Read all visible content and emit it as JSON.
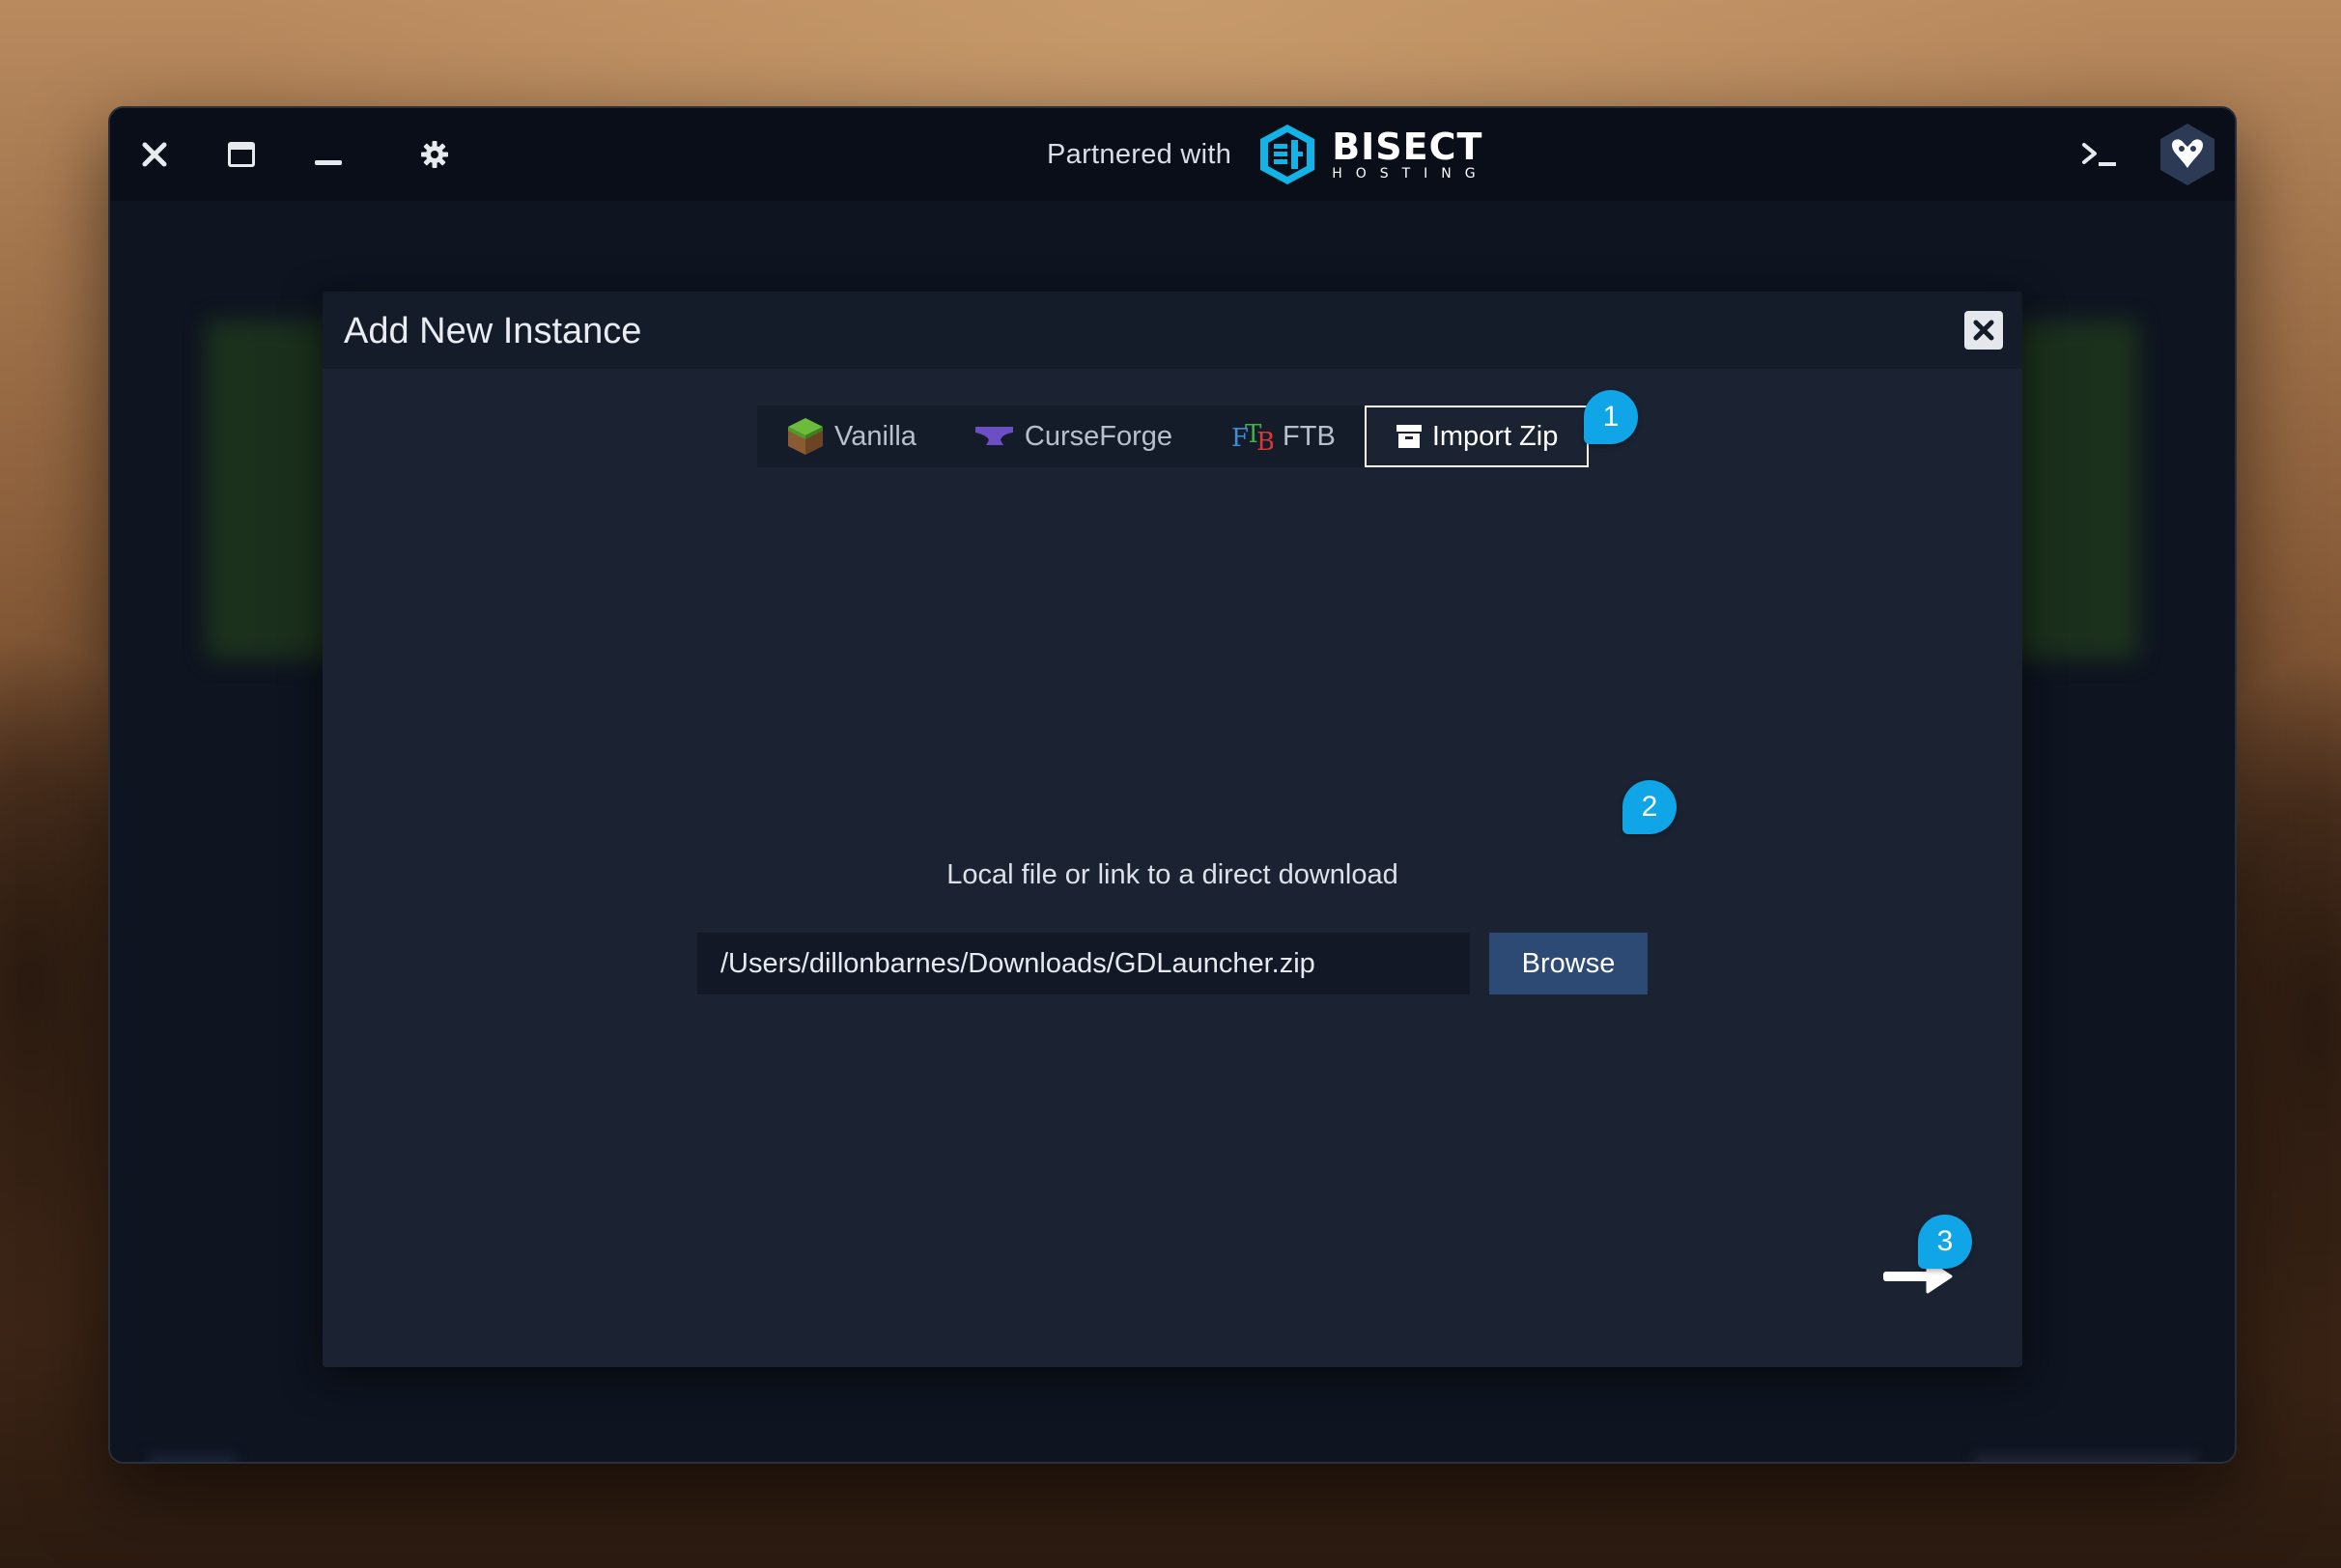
{
  "titlebar": {
    "partner_label": "Partnered with",
    "partner_brand": "BISECT",
    "partner_brand_sub": "HOSTING",
    "icons": [
      "close-icon",
      "maximize-icon",
      "minimize-icon",
      "settings-gear-icon",
      "terminal-icon",
      "profile-avatar-icon"
    ]
  },
  "modal": {
    "title": "Add New Instance",
    "close_icon": "close-icon",
    "tabs": [
      {
        "label": "Vanilla",
        "icon": "minecraft-grass-block-icon",
        "active": false
      },
      {
        "label": "CurseForge",
        "icon": "anvil-icon",
        "active": false
      },
      {
        "label": "FTB",
        "icon": "ftb-logo-icon",
        "active": false
      },
      {
        "label": "Import Zip",
        "icon": "archive-box-icon",
        "active": true
      }
    ],
    "prompt": "Local file or link to a direct download",
    "path_value": "/Users/dillonbarnes/Downloads/GDLauncher.zip",
    "browse_label": "Browse",
    "next_icon": "arrow-right-icon"
  },
  "callouts": [
    "1",
    "2",
    "3"
  ],
  "colors": {
    "accent": "#10a5e6",
    "modal_bg": "#1b2333",
    "header_bg": "#141b29",
    "browse_bg": "#2d4a75"
  }
}
